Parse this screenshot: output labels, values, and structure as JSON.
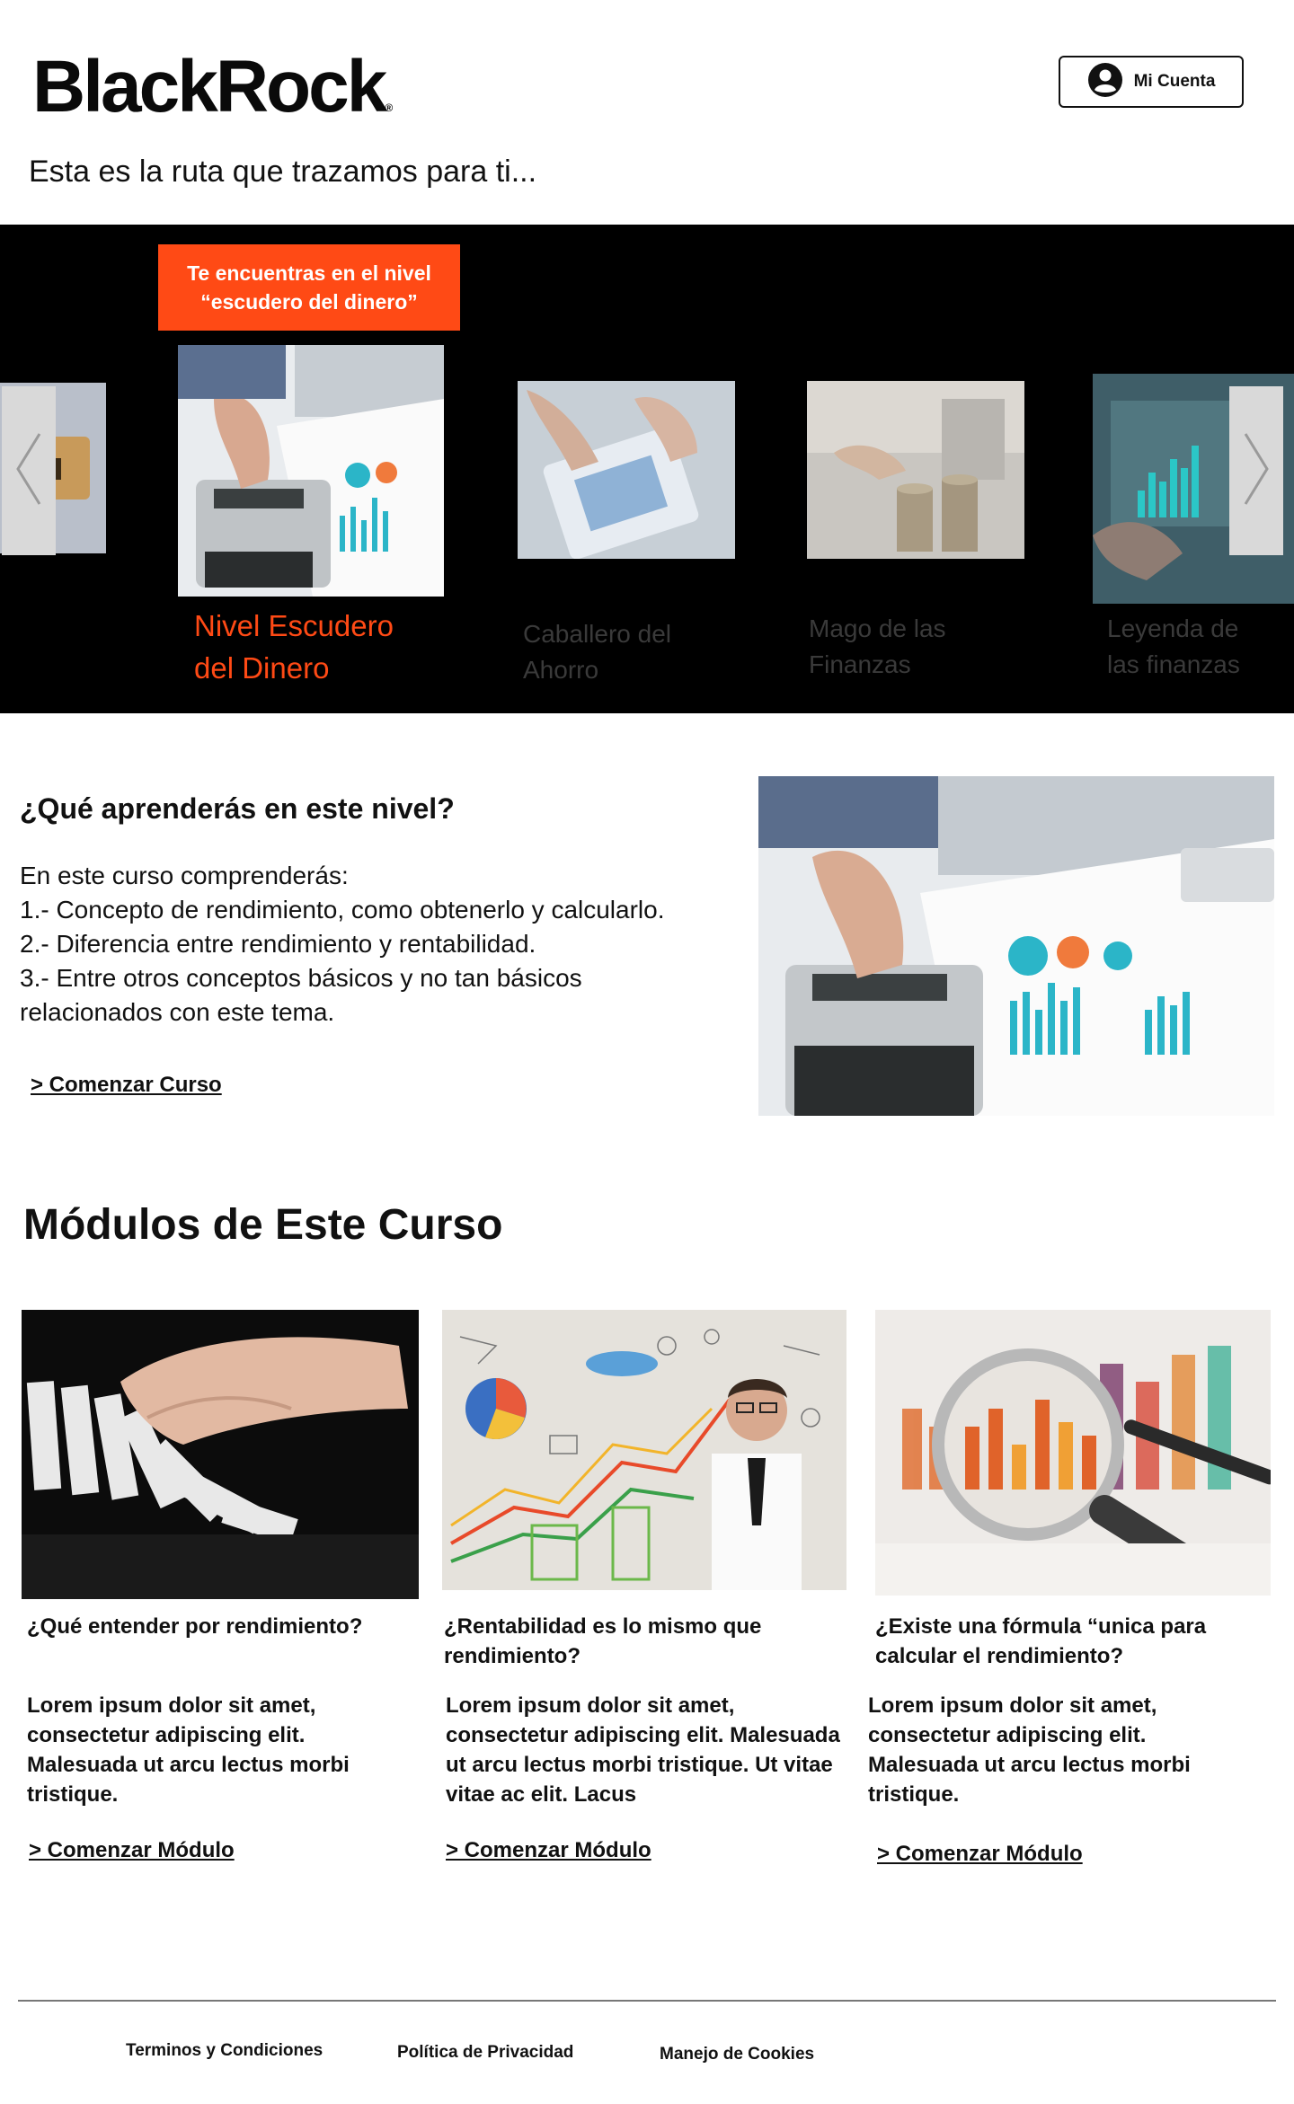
{
  "header": {
    "logo": "BlackRock",
    "logo_mark": "®",
    "account_label": "Mi Cuenta",
    "tagline": "Esta es la ruta que trazamos para ti..."
  },
  "carousel": {
    "badge_line1": "Te encuentras en el nivel",
    "badge_line2": "“escudero del dinero”",
    "levels": [
      {
        "line1": "Nivel Escudero",
        "line2": "del Dinero"
      },
      {
        "line1": "Caballero del",
        "line2": "Ahorro"
      },
      {
        "line1": "Mago de las",
        "line2": "Finanzas"
      },
      {
        "line1": "Leyenda de",
        "line2": "las finanzas"
      }
    ]
  },
  "course": {
    "title": "¿Qué aprenderás en este nivel?",
    "intro": "En este curso comprenderás:",
    "points": [
      "1.- Concepto de rendimiento, como obtenerlo y calcularlo.",
      "2.- Diferencia entre rendimiento y rentabilidad.",
      "3.- Entre otros conceptos básicos y no tan básicos\nrelacionados con este tema."
    ],
    "start_label": "> Comenzar Curso"
  },
  "modules": {
    "title": "Módulos de Este Curso",
    "items": [
      {
        "question": "¿Qué entender por rendimiento?",
        "body": "Lorem ipsum dolor sit amet, consectetur adipiscing elit. Malesuada ut arcu lectus morbi tristique.",
        "link": "> Comenzar Módulo"
      },
      {
        "question": "¿Rentabilidad es lo mismo que rendimiento?",
        "body": "Lorem ipsum dolor sit amet, consectetur adipiscing elit. Malesuada ut arcu lectus morbi tristique. Ut vitae vitae ac elit. Lacus",
        "link": "> Comenzar Módulo"
      },
      {
        "question": "¿Existe una fórmula “unica para calcular el rendimiento?",
        "body": "Lorem ipsum dolor sit amet, consectetur adipiscing elit. Malesuada ut arcu lectus morbi tristique.",
        "link": "> Comenzar Módulo"
      }
    ]
  },
  "footer": {
    "terms": "Terminos y Condiciones",
    "privacy": "Política de Privacidad",
    "cookies": "Manejo de Cookies"
  },
  "colors": {
    "accent": "#ff4a15",
    "carousel_bg": "#000000"
  }
}
